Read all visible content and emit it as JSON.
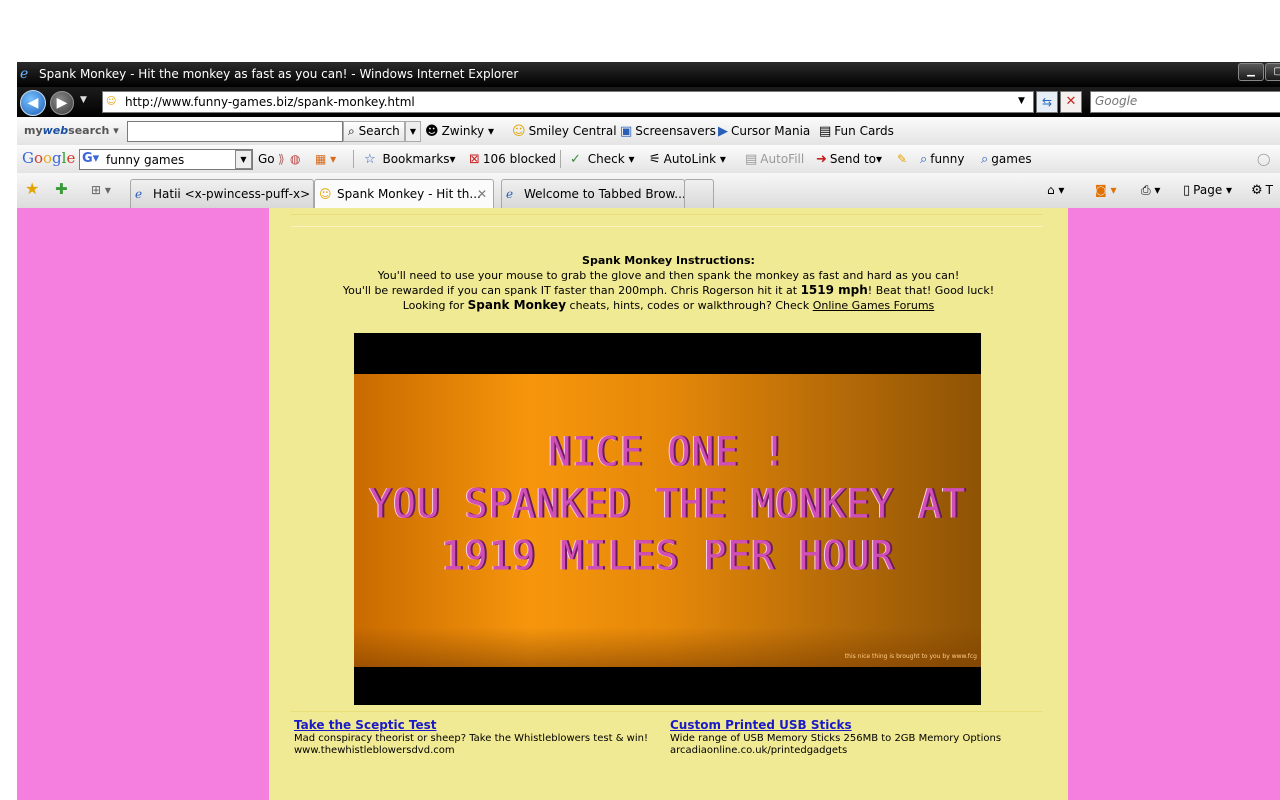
{
  "window": {
    "title": "Spank Monkey - Hit the monkey as fast as you can! - Windows Internet Explorer"
  },
  "address_bar": {
    "url": "http://www.funny-games.biz/spank-monkey.html",
    "search_placeholder": "Google"
  },
  "mywebsearch_toolbar": {
    "logo_prefix": "my",
    "logo_web": "web",
    "logo_suffix": "search",
    "search_button": "Search",
    "items": [
      "Zwinky",
      "Smiley Central",
      "Screensavers",
      "Cursor Mania",
      "Fun Cards"
    ]
  },
  "google_toolbar": {
    "logo": [
      "G",
      "o",
      "o",
      "g",
      "l",
      "e"
    ],
    "query": "funny games",
    "go_label": "Go",
    "bookmarks_label": "Bookmarks",
    "blocked_label": "106 blocked",
    "check_label": "Check",
    "autolink_label": "AutoLink",
    "autofill_label": "AutoFill",
    "sendto_label": "Send to",
    "highlight_terms": [
      "funny",
      "games"
    ]
  },
  "tabs": [
    {
      "label": "Hatii <x-pwincess-puff-x>",
      "active": false
    },
    {
      "label": "Spank Monkey - Hit th...",
      "active": true
    },
    {
      "label": "Welcome to Tabbed Brow...",
      "active": false
    }
  ],
  "command_bar": {
    "page_label": "Page",
    "tools_label": "T"
  },
  "instructions": {
    "heading": "Spank Monkey Instructions:",
    "line1": "You'll need to use your mouse to grab the glove and then spank the monkey as fast and hard as you can!",
    "line2_before": "You'll be rewarded if you can spank IT faster than 200mph. Chris Rogerson hit it at ",
    "line2_bold": "1519 mph",
    "line2_after": "! Beat that! Good luck!",
    "line3_before": "Looking for ",
    "line3_bold": "Spank Monkey",
    "line3_middle": " cheats, hints, codes or walkthrough? Check ",
    "line3_link": "Online Games Forums"
  },
  "game": {
    "message_lines": [
      "NICE ONE !",
      "YOU SPANKED THE MONKEY AT",
      "1919 MILES PER HOUR"
    ],
    "credit": "this nice thing is brought to you by www.fcg"
  },
  "ads": [
    {
      "title": "Take the Sceptic Test",
      "body": "Mad conspiracy theorist or sheep? Take the Whistleblowers test & win!",
      "url": "www.thewhistleblowersdvd.com"
    },
    {
      "title": "Custom Printed USB Sticks",
      "body": "Wide range of USB Memory Sticks 256MB to 2GB Memory Options",
      "url": "arcadiaonline.co.uk/printedgadgets"
    }
  ],
  "colors": {
    "page_background": "#f57fdf",
    "content_background": "#f1ea94",
    "ad_link": "#1a1ac8"
  }
}
